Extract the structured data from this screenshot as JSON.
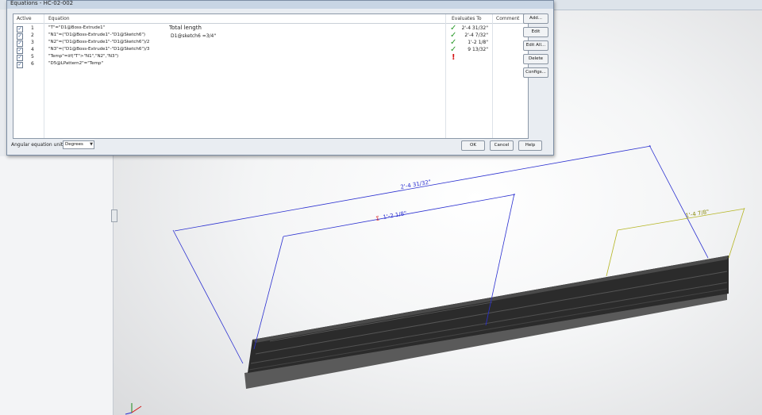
{
  "dialog": {
    "title": "Equations - HC-02-002",
    "headers": {
      "active": "Active",
      "equation": "Equation",
      "evaluates_to": "Evaluates To",
      "comment": "Comment"
    },
    "rows": [
      {
        "num": "1",
        "equation": "\"T\"=\"D1@Boss-Extrude1\"",
        "note": "Total length",
        "status": "ok",
        "evaluates_to": "2'-4 31/32\""
      },
      {
        "num": "2",
        "equation": "\"N1\"=(\"D1@Boss-Extrude1\"-\"D1@Sketch6\")",
        "note": "D1@sketch6 =3/4\"",
        "status": "ok",
        "evaluates_to": "2'-4 7/32\""
      },
      {
        "num": "3",
        "equation": "\"N2\"=(\"D1@Boss-Extrude1\"-\"D1@Sketch6\")/2",
        "note": "",
        "status": "ok",
        "evaluates_to": "1'-2 1/8\""
      },
      {
        "num": "4",
        "equation": "\"N3\"=(\"D1@Boss-Extrude1\"-\"D1@Sketch6\")/3",
        "note": "",
        "status": "ok",
        "evaluates_to": "9 13/32\""
      },
      {
        "num": "5",
        "equation": "\"Temp\"=iif(\"T\">\"N1\",\"N2\",\"N3\")",
        "note": "",
        "status": "error",
        "evaluates_to": ""
      },
      {
        "num": "6",
        "equation": "\"D5@LPattern2\"=\"Temp\"",
        "note": "",
        "status": "none",
        "evaluates_to": ""
      }
    ],
    "side_buttons": {
      "add": "Add...",
      "edit": "Edit",
      "edit_all": "Edit All...",
      "delete": "Delete",
      "configs": "Configs..."
    },
    "angular_label": "Angular equation unit",
    "angular_value": "Degrees",
    "ok": "OK",
    "cancel": "Cancel",
    "help": "Help"
  },
  "viewport": {
    "dim_total": "2'-4 31/32\"",
    "dim_middle": "1'-2 1/8\"",
    "dim_middle_prefix": "Σ",
    "dim_right": "1'-4 7/8\"",
    "colors": {
      "dim_blue": "#2a2fd0",
      "dim_olive": "#b5b522",
      "part": "#2b2b2b",
      "error_red": "#d41414"
    }
  }
}
